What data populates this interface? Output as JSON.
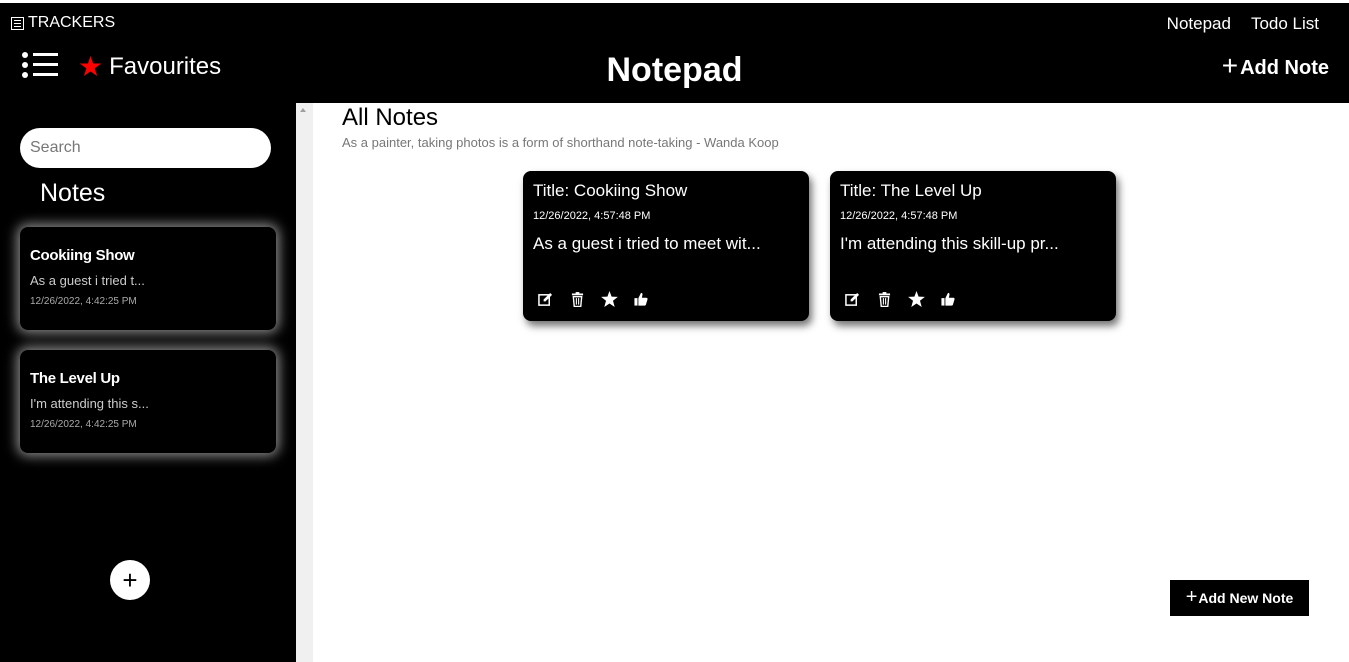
{
  "header": {
    "brand": "TRACKERS",
    "links": [
      "Notepad",
      "Todo List"
    ],
    "favourites_label": "Favourites",
    "page_title": "Notepad",
    "add_note_label": "Add Note"
  },
  "sidebar": {
    "search_placeholder": "Search",
    "notes_heading": "Notes",
    "cards": [
      {
        "title": "Cookiing Show",
        "snippet": "As a guest i tried t...",
        "date": "12/26/2022, 4:42:25 PM"
      },
      {
        "title": "The Level Up",
        "snippet": "I'm attending this s...",
        "date": "12/26/2022, 4:42:25 PM"
      }
    ],
    "add_button": "+"
  },
  "main": {
    "title": "All Notes",
    "quote": "As a painter, taking photos is a form of shorthand note-taking - Wanda Koop",
    "notes": [
      {
        "title": "Title: Cookiing Show",
        "date": "12/26/2022, 4:57:48 PM",
        "body": "As a guest i tried to meet wit..."
      },
      {
        "title": "Title: The Level Up",
        "date": "12/26/2022, 4:57:48 PM",
        "body": "I'm attending this skill-up pr..."
      }
    ],
    "add_new_label": "Add New Note"
  },
  "icons": {
    "edit": "edit-icon",
    "delete": "trash-icon",
    "favourite": "star-icon",
    "like": "thumbs-up-icon"
  },
  "colors": {
    "accent_star": "#ff0000",
    "bar_bg": "#000000",
    "page_bg": "#ffffff"
  }
}
